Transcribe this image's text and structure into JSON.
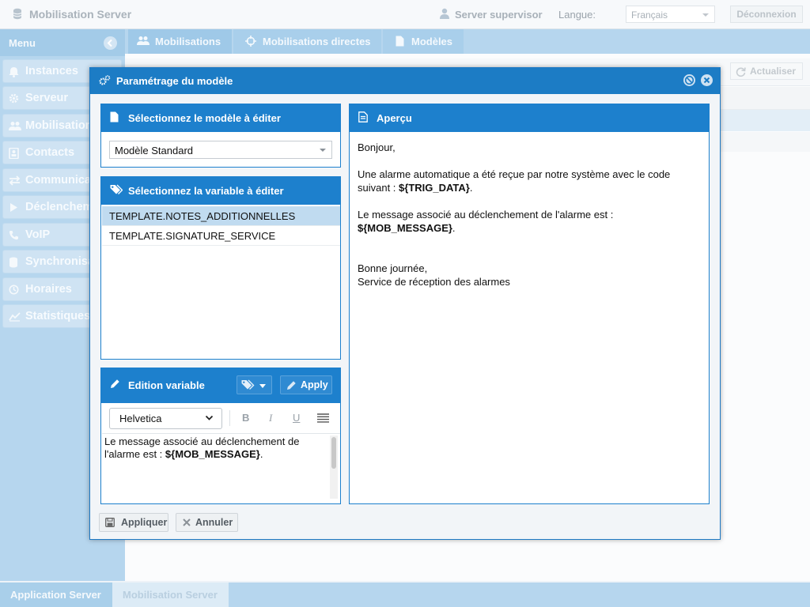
{
  "header": {
    "app_title": "Mobilisation Server",
    "user_name": "Server supervisor",
    "language_label": "Langue:",
    "language_value": "Français",
    "logout_label": "Déconnexion"
  },
  "sidebar": {
    "title": "Menu",
    "items": [
      {
        "label": "Instances",
        "icon": "bell-icon"
      },
      {
        "label": "Serveur",
        "icon": "gear-icon"
      },
      {
        "label": "Mobilisations",
        "icon": "users-icon"
      },
      {
        "label": "Contacts",
        "icon": "address-book-icon"
      },
      {
        "label": "Communications",
        "icon": "exchange-icon"
      },
      {
        "label": "Déclenchements",
        "icon": "play-icon"
      },
      {
        "label": "VoIP",
        "icon": "phone-icon"
      },
      {
        "label": "Synchronisation",
        "icon": "database-icon"
      },
      {
        "label": "Horaires",
        "icon": "clock-icon"
      },
      {
        "label": "Statistiques",
        "icon": "chart-icon"
      }
    ]
  },
  "tabs": [
    {
      "label": "Mobilisations",
      "icon": "users-icon"
    },
    {
      "label": "Mobilisations directes",
      "icon": "crosshair-icon"
    },
    {
      "label": "Modèles",
      "icon": "file-icon"
    }
  ],
  "toolbar": {
    "refresh_label": "Actualiser"
  },
  "modal": {
    "title": "Paramétrage du modèle",
    "model_panel_title": "Sélectionnez le modèle à éditer",
    "model_value": "Modèle Standard",
    "variable_panel_title": "Sélectionnez la variable à éditer",
    "variables": [
      {
        "label": "TEMPLATE.NOTES_ADDITIONNELLES",
        "selected": true
      },
      {
        "label": "TEMPLATE.SIGNATURE_SERVICE",
        "selected": false
      }
    ],
    "edit_panel_title": "Edition variable",
    "apply_label": "Apply",
    "font_value": "Helvetica",
    "format_buttons": {
      "bold": "B",
      "italic": "I",
      "underline": "U"
    },
    "editor_text_before": "Le message associé au déclenchement de l'alarme est : ",
    "editor_var": "${MOB_MESSAGE}",
    "editor_text_after": ".",
    "preview_title": "Aperçu",
    "preview": {
      "greeting": "Bonjour,",
      "line1": "Une alarme automatique a été reçue par notre système avec le code suivant : ",
      "line1_var": "${TRIG_DATA}",
      "line1_end": ".",
      "line2": "Le message associé au déclenchement de l'alarme est :",
      "line2_var": "${MOB_MESSAGE}",
      "line2_end": ".",
      "closing": "Bonne journée,",
      "signature": "Service de réception des alarmes"
    },
    "footer_apply_label": "Appliquer",
    "footer_cancel_label": "Annuler"
  },
  "bottom_tabs": [
    "Application Server",
    "Mobilisation Server"
  ],
  "colors": {
    "accent": "#1d80cd",
    "sidebar": "#b6d6ee",
    "selected_row": "#c0dbf0"
  }
}
